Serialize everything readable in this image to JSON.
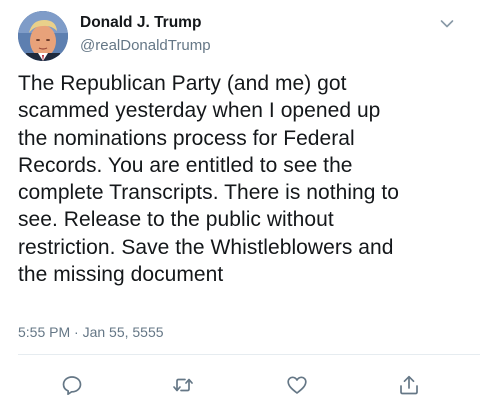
{
  "author": {
    "display_name": "Donald J. Trump",
    "handle": "@realDonaldTrump",
    "avatar_icon": "profile-photo"
  },
  "tweet": {
    "text": "The Republican Party (and me) got\nscammed yesterday when I opened up\nthe nominations process for Federal\nRecords. You are entitled to see the\ncomplete Transcripts. There is nothing to\nsee. Release to the public without\nrestriction. Save the Whistleblowers and\nthe missing document",
    "timestamp": "5:55 PM · Jan 55, 5555"
  },
  "actions": [
    {
      "name": "reply",
      "icon": "reply-icon"
    },
    {
      "name": "retweet",
      "icon": "retweet-icon"
    },
    {
      "name": "like",
      "icon": "heart-icon"
    },
    {
      "name": "share",
      "icon": "share-icon"
    }
  ],
  "colors": {
    "text_primary": "#14171a",
    "text_secondary": "#657786",
    "icon": "#657786",
    "divider": "#e6ecf0"
  }
}
